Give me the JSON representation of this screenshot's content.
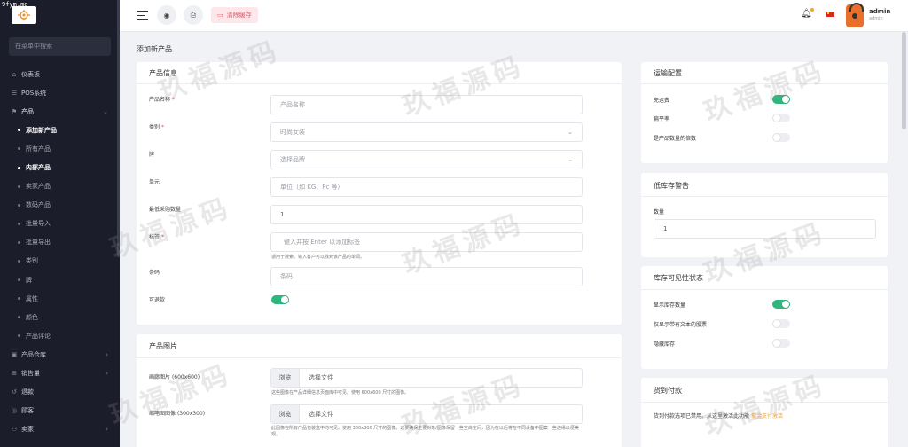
{
  "domain_tag": "9fym.me",
  "sidebar": {
    "search_placeholder": "在菜单中搜索",
    "items": [
      {
        "label": "仪表板",
        "icon": "home-icon",
        "kind": "top"
      },
      {
        "label": "POS系统",
        "icon": "list-icon",
        "kind": "top"
      },
      {
        "label": "产品",
        "icon": "tag-icon",
        "kind": "open"
      },
      {
        "label": "添加新产品",
        "kind": "sub",
        "bright": true
      },
      {
        "label": "所有产品",
        "kind": "sub"
      },
      {
        "label": "内部产品",
        "kind": "sub",
        "bright": true
      },
      {
        "label": "卖家产品",
        "kind": "sub"
      },
      {
        "label": "数码产品",
        "kind": "sub"
      },
      {
        "label": "批量导入",
        "kind": "sub"
      },
      {
        "label": "批量导出",
        "kind": "sub"
      },
      {
        "label": "类别",
        "kind": "sub"
      },
      {
        "label": "牌",
        "kind": "sub"
      },
      {
        "label": "属性",
        "kind": "sub"
      },
      {
        "label": "颜色",
        "kind": "sub"
      },
      {
        "label": "产品评论",
        "kind": "sub"
      },
      {
        "label": "产品仓库",
        "icon": "box-icon",
        "kind": "top",
        "chevron": true
      },
      {
        "label": "销售量",
        "icon": "cart-icon",
        "kind": "top",
        "chevron": true
      },
      {
        "label": "退款",
        "icon": "refund-icon",
        "kind": "top"
      },
      {
        "label": "顾客",
        "icon": "user-icon",
        "kind": "top"
      },
      {
        "label": "卖家",
        "icon": "seller-icon",
        "kind": "top",
        "chevron": true
      }
    ]
  },
  "header": {
    "clear_cache_label": "清除缓存",
    "user_name": "admin",
    "user_role": "admin"
  },
  "page": {
    "title": "添加新产品"
  },
  "product_info": {
    "title": "产品信息",
    "fields": {
      "name_label": "产品名称",
      "name_placeholder": "产品名称",
      "category_label": "类别",
      "category_value": "时尚女装",
      "brand_label": "牌",
      "brand_placeholder": "选择品牌",
      "unit_label": "单元",
      "unit_placeholder": "单位（如 KG、Pc 等）",
      "min_qty_label": "最低采购数量",
      "min_qty_value": "1",
      "tags_label": "标签",
      "tags_placeholder": "键入并按 Enter 以添加标签",
      "tags_hint": "适用于搜索。输入客户可以找到该产品的单词。",
      "barcode_label": "条码",
      "barcode_placeholder": "条码",
      "refundable_label": "可退款",
      "refundable_on": true
    }
  },
  "product_images": {
    "title": "产品图片",
    "gallery_label": "画廊图片",
    "gallery_size": "(600x600)",
    "gallery_browse": "浏览",
    "gallery_file": "选择文件",
    "gallery_hint": "这些图像在产品详细信息页面库中可见。使用 600x600 尺寸的图像。",
    "thumb_label": "缩略图图像",
    "thumb_size": "(300x300)",
    "thumb_browse": "浏览",
    "thumb_file": "选择文件",
    "thumb_hint": "此图像在所有产品包装盒中均可见。使用 300x300 尺寸的图像。这要确保主要对象/图像保留一些空白空间，因为在以后将在不同设备中图案一些边缘以便美观。"
  },
  "shipping": {
    "title": "运输配置",
    "free_label": "免运费",
    "free_on": true,
    "flat_label": "扁平率",
    "flat_on": false,
    "multiply_label": "是产品数量的倍数",
    "multiply_on": false
  },
  "low_stock": {
    "title": "低库存警告",
    "qty_label": "数量",
    "qty_value": "1"
  },
  "stock_visibility": {
    "title": "库存可见性状态",
    "show_qty_label": "显示库存数量",
    "show_qty_on": true,
    "text_only_label": "仅显示带有文本的股票",
    "text_only_on": false,
    "hide_label": "隐藏库存",
    "hide_on": false
  },
  "cod": {
    "title": "货到付款",
    "text": "货到付款选项已禁用。从这里激活此功能",
    "link": "现金支付激活"
  },
  "watermark": "玖福源码",
  "colors": {
    "sidebar_bg": "#1b1d2a",
    "toggle_on": "#2eb67d",
    "required": "#e05565",
    "link": "#f2a33a"
  }
}
